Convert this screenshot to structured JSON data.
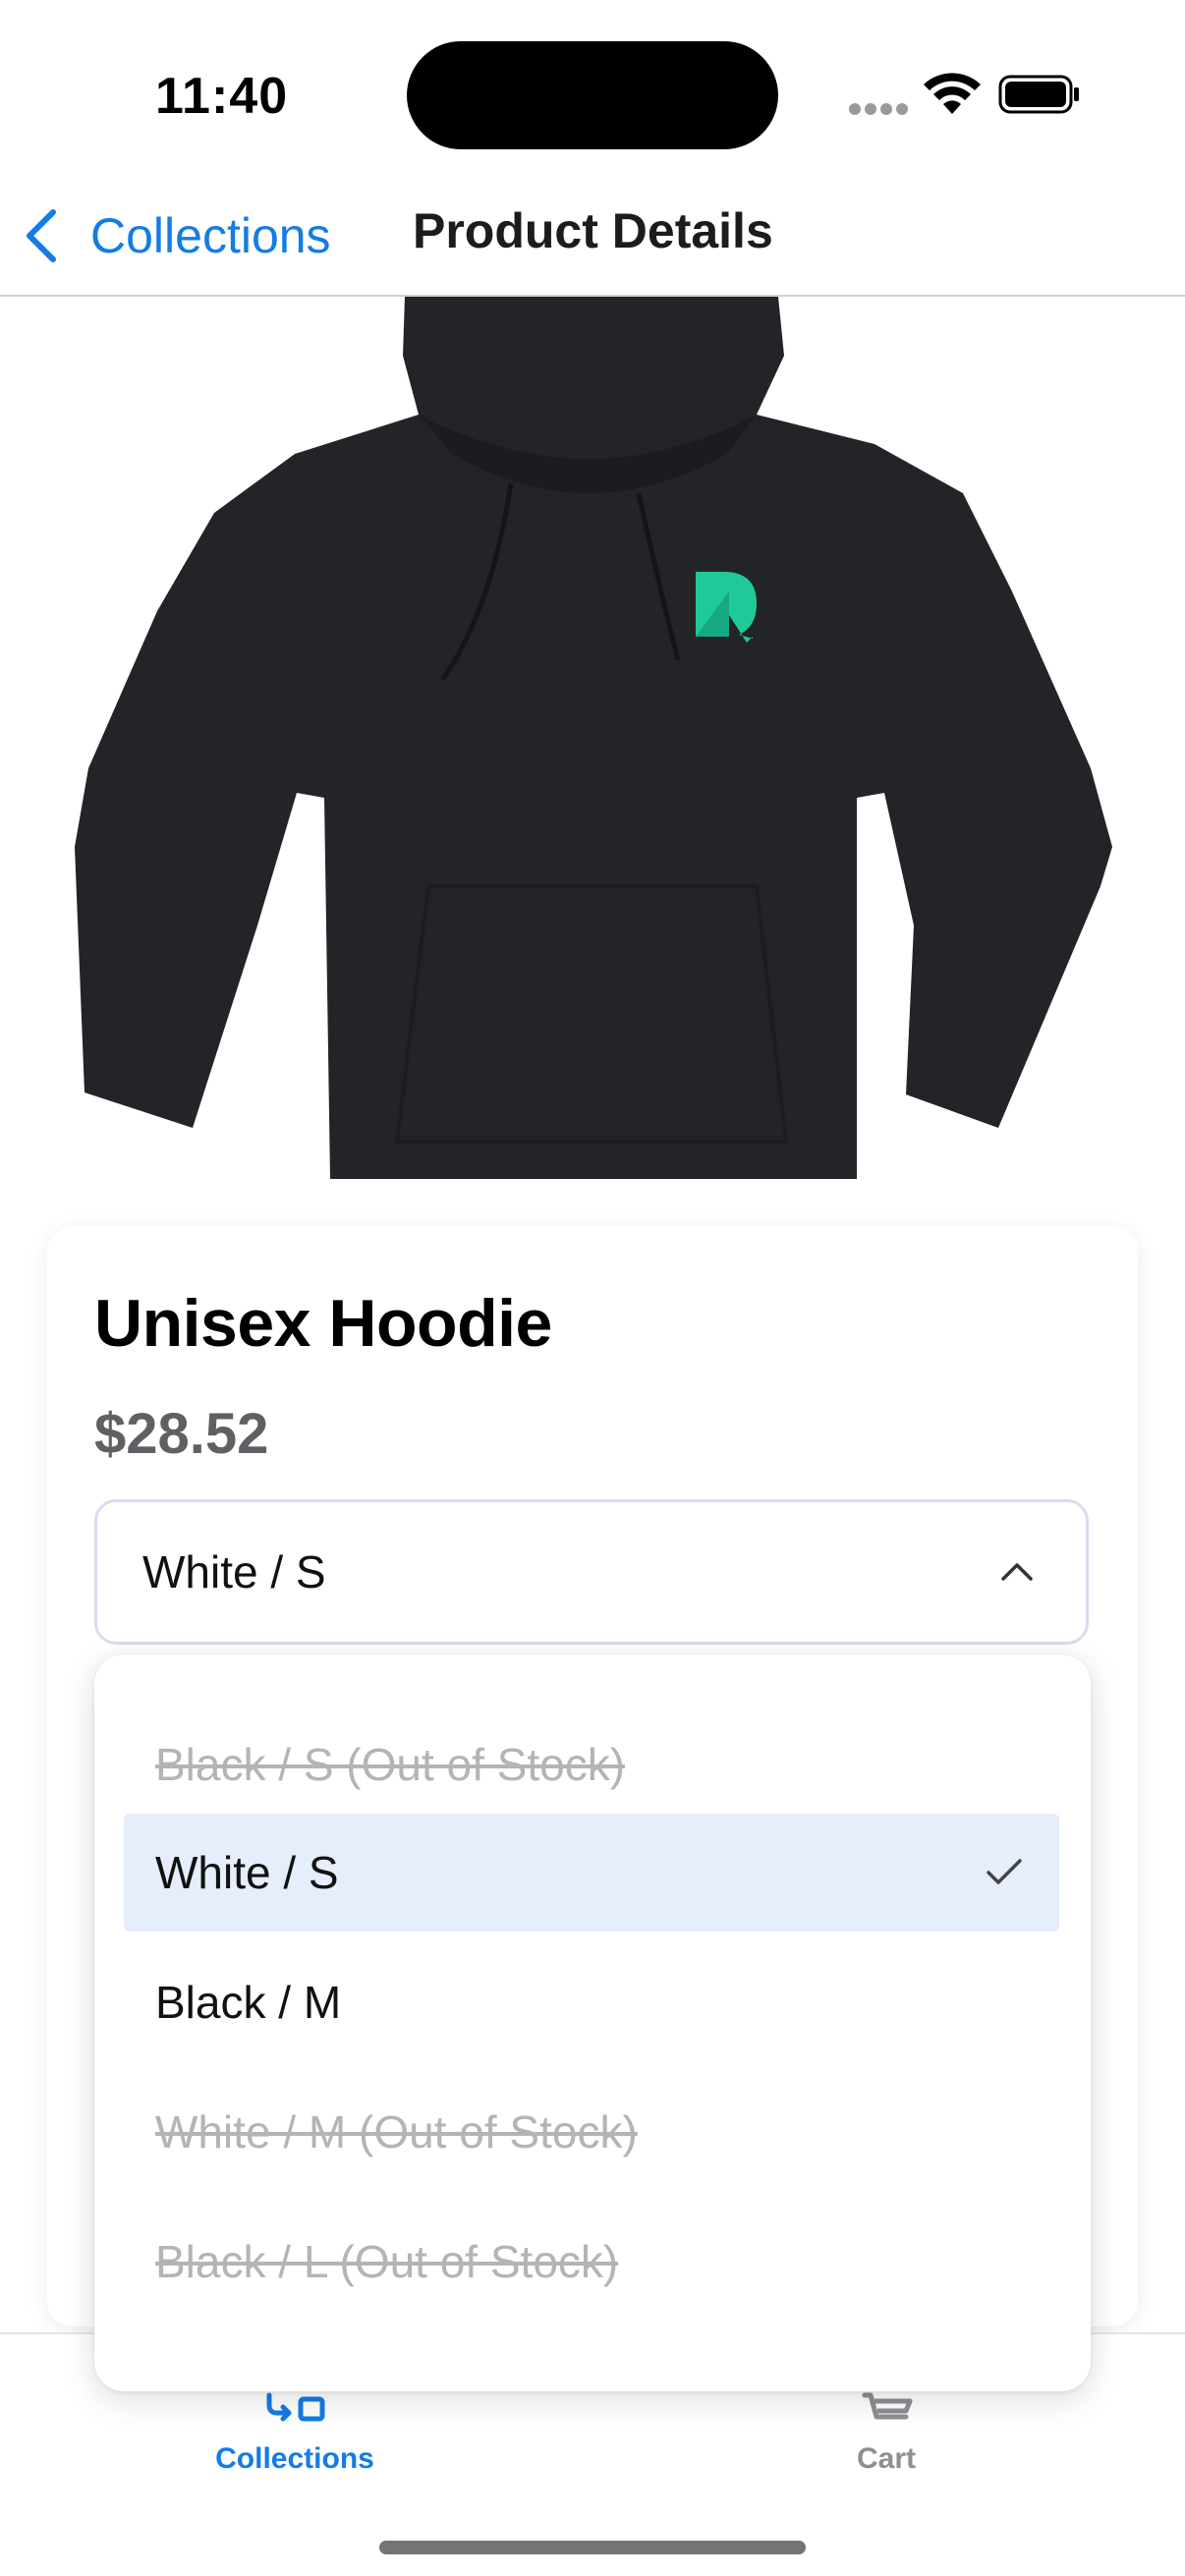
{
  "status_bar": {
    "time": "11:40",
    "icons": [
      "signal-icon",
      "wifi-icon",
      "battery-icon"
    ]
  },
  "nav": {
    "back_label": "Collections",
    "title": "Product Details"
  },
  "product": {
    "image_icon": "hoodie-image",
    "name": "Unisex Hoodie",
    "price": "$28.52"
  },
  "variant_select": {
    "value": "White / S",
    "expanded": true
  },
  "dropdown": {
    "options": [
      {
        "label": "Black / S (Out of Stock)",
        "state": "disabled"
      },
      {
        "label": "White / S",
        "state": "selected"
      },
      {
        "label": "Black / M",
        "state": "available"
      },
      {
        "label": "White / M (Out of Stock)",
        "state": "disabled"
      },
      {
        "label": "Black / L (Out of Stock)",
        "state": "disabled"
      }
    ]
  },
  "tabs": [
    {
      "label": "Collections",
      "icon": "collections-icon",
      "active": true
    },
    {
      "label": "Cart",
      "icon": "cart-icon",
      "active": false
    }
  ],
  "colors": {
    "accent": "#147ce5",
    "selected_bg": "#e6edfb",
    "disabled_text": "#b4b4b4",
    "hoodie": "#232428",
    "logo": "#1fc99a"
  }
}
